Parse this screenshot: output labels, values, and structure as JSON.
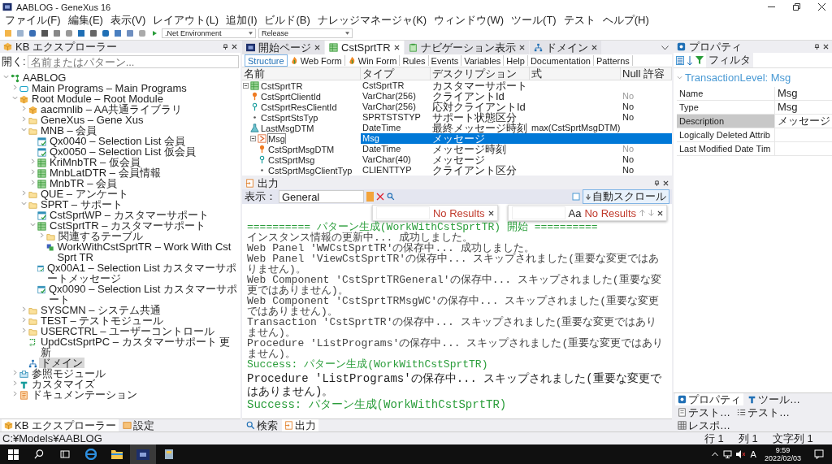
{
  "window": {
    "title": "AABLOG - GeneXus 16"
  },
  "menu": [
    "ファイル(F)",
    "編集(E)",
    "表示(V)",
    "レイアウト(L)",
    "追加(I)",
    "ビルド(B)",
    "ナレッジマネージャ(K)",
    "ウィンドウ(W)",
    "ツール(T)",
    "テスト",
    "ヘルプ(H)"
  ],
  "toolbar": {
    "environment": ".Net Environment",
    "configuration": "Release"
  },
  "kb_explorer": {
    "title": "KB エクスプローラー",
    "search_label": "開く:",
    "search_placeholder": "名前またはパターン...",
    "tree": [
      {
        "label": "AABLOG",
        "kind": "kb",
        "expanded": true,
        "selected": false,
        "children": [
          {
            "label": "Main Programs – Main Programs",
            "kind": "mainprog",
            "expanded": false,
            "selected": false
          },
          {
            "label": "Root Module – Root Module",
            "kind": "module",
            "expanded": true,
            "selected": false,
            "children": [
              {
                "label": "aacmnlib – AA共通ライブラリ",
                "kind": "module",
                "expanded": false,
                "selected": false
              },
              {
                "label": "GeneXus – Gene Xus",
                "kind": "folder",
                "expanded": false,
                "selected": false
              },
              {
                "label": "MNB – 会員",
                "kind": "folder",
                "expanded": true,
                "selected": false,
                "children": [
                  {
                    "label": "Qx0040 – Selection List 会員",
                    "kind": "webpanel",
                    "selected": false
                  },
                  {
                    "label": "Qx0050 – Selection List 仮会員",
                    "kind": "webpanel",
                    "selected": false
                  },
                  {
                    "label": "KriMnbTR – 仮会員",
                    "kind": "transaction",
                    "expanded": false,
                    "selected": false
                  },
                  {
                    "label": "MnbLatDTR – 会員情報",
                    "kind": "transaction",
                    "expanded": false,
                    "selected": false
                  },
                  {
                    "label": "MnbTR – 会員",
                    "kind": "transaction",
                    "expanded": false,
                    "selected": false
                  }
                ]
              },
              {
                "label": "QUE – アンケート",
                "kind": "folder",
                "expanded": false,
                "selected": false
              },
              {
                "label": "SPRT – サポート",
                "kind": "folder",
                "expanded": true,
                "selected": false,
                "children": [
                  {
                    "label": "CstSprtWP – カスタマーサポート",
                    "kind": "webpanel",
                    "selected": false
                  },
                  {
                    "label": "CstSprtTR – カスタマーサポート",
                    "kind": "transaction",
                    "expanded": true,
                    "selected": false,
                    "children": [
                      {
                        "label": "関連するテーブル",
                        "kind": "folder",
                        "expanded": false,
                        "selected": false
                      },
                      {
                        "label": "WorkWithCstSprtTR – Work With Cst Sprt TR",
                        "kind": "workwith",
                        "selected": false
                      }
                    ]
                  },
                  {
                    "label": "Qx00A1 – Selection List カスタマーサポートメッセージ",
                    "kind": "webpanel",
                    "selected": false
                  },
                  {
                    "label": "Qx0090 – Selection List カスタマーサポート",
                    "kind": "webpanel",
                    "selected": false
                  }
                ]
              },
              {
                "label": "SYSCMN – システム共通",
                "kind": "folder",
                "expanded": false,
                "selected": false
              },
              {
                "label": "TEST – テストモジュール",
                "kind": "folder",
                "expanded": false,
                "selected": false
              },
              {
                "label": "USERCTRL – ユーザーコントロール",
                "kind": "folder",
                "expanded": false,
                "selected": false
              },
              {
                "label": "UpdCstSprtPC – カスタマーサポート 更新",
                "kind": "procedure",
                "selected": false
              },
              {
                "label": "ドメイン",
                "kind": "domain",
                "selected": true
              }
            ]
          },
          {
            "label": "参照モジュール",
            "kind": "reference",
            "expanded": false,
            "selected": false
          },
          {
            "label": "カスタマイズ",
            "kind": "customize",
            "expanded": false,
            "selected": false
          },
          {
            "label": "ドキュメンテーション",
            "kind": "docs",
            "expanded": false,
            "selected": false
          }
        ]
      }
    ]
  },
  "editor_tabs": [
    {
      "label": "開始ページ",
      "kind": "startpage",
      "selected": false
    },
    {
      "label": "CstSprtTR",
      "kind": "transaction",
      "selected": true
    },
    {
      "label": "ナビゲーション表示",
      "kind": "navigation",
      "selected": false
    },
    {
      "label": "ドメイン",
      "kind": "domain",
      "selected": false
    }
  ],
  "section_tabs": [
    {
      "label": "Structure",
      "kind": "text",
      "selected": true
    },
    {
      "label": "Web Form",
      "kind": "form",
      "selected": false
    },
    {
      "label": "Win Form",
      "kind": "form",
      "selected": false
    },
    {
      "label": "Rules",
      "kind": "text",
      "selected": false
    },
    {
      "label": "Events",
      "kind": "text",
      "selected": false
    },
    {
      "label": "Variables",
      "kind": "text",
      "selected": false
    },
    {
      "label": "Help",
      "kind": "text",
      "selected": false
    },
    {
      "label": "Documentation",
      "kind": "text",
      "selected": false
    },
    {
      "label": "Patterns",
      "kind": "text",
      "selected": false
    }
  ],
  "structure": {
    "columns": [
      "名前",
      "タイプ",
      "デスクリプション",
      "式",
      "Null 許容"
    ],
    "rows": [
      {
        "name": "CstSprtTR",
        "type": "CstSprtTR",
        "description": "カスタマーサポート",
        "kind": "transaction",
        "expanded": true,
        "selected": false,
        "children": [
          {
            "name": "CstSprtClientId",
            "type": "VarChar(256)",
            "description": "クライアントId",
            "nullable": "No",
            "null_disabled": true,
            "kind": "key",
            "selected": false
          },
          {
            "name": "CstSprtResClientId",
            "type": "VarChar(256)",
            "description": "応対クライアントId",
            "nullable": "No",
            "null_disabled": false,
            "kind": "subkey",
            "selected": false
          },
          {
            "name": "CstSprtStsTyp",
            "type": "SPRTSTSTYP",
            "description": "サポート状態区分",
            "nullable": "No",
            "null_disabled": false,
            "kind": "attr",
            "selected": false
          },
          {
            "name": "LastMsgDTM",
            "type": "DateTime",
            "description": "最終メッセージ時刻",
            "formula": "max(CstSprtMsgDTM)",
            "kind": "formula",
            "selected": false
          },
          {
            "name": "Msg",
            "type": "Msg",
            "description": "メッセージ",
            "kind": "level",
            "expanded": true,
            "selected": true,
            "children": [
              {
                "name": "CstSprtMsgDTM",
                "type": "DateTime",
                "description": "メッセージ時刻",
                "nullable": "No",
                "null_disabled": true,
                "kind": "key",
                "selected": false
              },
              {
                "name": "CstSprtMsg",
                "type": "VarChar(40)",
                "description": "メッセージ",
                "nullable": "No",
                "null_disabled": false,
                "kind": "subkey",
                "selected": false
              },
              {
                "name": "CstSprtMsgClientTyp",
                "type": "CLIENTTYP",
                "description": "クライアント区分",
                "nullable": "No",
                "null_disabled": false,
                "kind": "attr",
                "selected": false
              }
            ]
          }
        ]
      }
    ]
  },
  "properties": {
    "title": "プロパティ",
    "filter_label": "フィルタ",
    "group": {
      "label": "TransactionLevel: Msg",
      "expanded": true
    },
    "rows": [
      {
        "name": "Name",
        "value": "Msg",
        "selected": false
      },
      {
        "name": "Type",
        "value": "Msg",
        "selected": false
      },
      {
        "name": "Description",
        "value": "メッセージ",
        "selected": true
      },
      {
        "name": "Logically Deleted Attrib",
        "selected": false
      },
      {
        "name": "Last Modified Date Tim",
        "selected": false
      }
    ]
  },
  "output": {
    "title": "出力",
    "show_label": "表示：",
    "channel": "General",
    "auto_scroll": "自動スクロール",
    "find_small": {
      "status": "No Results"
    },
    "find_large": {
      "case_label": "Aa",
      "status": "No Results"
    },
    "lines": [
      {
        "kind": "header",
        "text": "========== パターン生成(WorkWithCstSprtTR) 開始 =========="
      },
      {
        "kind": "normal",
        "text": "インスタンス情報の更新中... 成功しました。"
      },
      {
        "kind": "normal",
        "text": "Web Panel 'WWCstSprtTR'の保存中... 成功しました。"
      },
      {
        "kind": "normal",
        "text": "Web Panel 'ViewCstSprtTR'の保存中... スキップされました(重要な変更ではありません)。"
      },
      {
        "kind": "normal",
        "text": "Web Component 'CstSprtTRGeneral'の保存中... スキップされました(重要な変更ではありません)。"
      },
      {
        "kind": "normal",
        "text": "Web Component 'CstSprtTRMsgWC'の保存中... スキップされました(重要な変更ではありません)。"
      },
      {
        "kind": "normal",
        "text": "Transaction 'CstSprtTR'の保存中... スキップされました(重要な変更ではありません)。"
      },
      {
        "kind": "normal",
        "text": "Procedure 'ListPrograms'の保存中... スキップされました(重要な変更ではありません)。"
      },
      {
        "kind": "success",
        "text": "Success: パターン生成(WorkWithCstSprtTR)"
      }
    ],
    "large_lines": [
      {
        "kind": "normal",
        "text": "Procedure 'ListPrograms'の保存中... スキップされました(重要な変更ではありません)。"
      },
      {
        "kind": "success",
        "text": "Success: パターン生成(WorkWithCstSprtTR)"
      }
    ]
  },
  "bottom_tabs": {
    "left": [
      {
        "label": "KB エクスプローラー",
        "kind": "module",
        "selected": true
      },
      {
        "label": "設定",
        "kind": "settings",
        "selected": false
      }
    ],
    "center": [
      {
        "label": "検索",
        "kind": "search",
        "selected": false
      },
      {
        "label": "出力",
        "kind": "output",
        "selected": true
      }
    ],
    "right": [
      {
        "label": "プロパティ",
        "kind": "properties",
        "selected": true
      },
      {
        "label": "ツール…",
        "kind": "tool",
        "selected": false
      },
      {
        "label": "テスト…",
        "kind": "test",
        "selected": false
      },
      {
        "label": "テスト…",
        "kind": "list",
        "selected": false
      },
      {
        "label": "レスポ…",
        "kind": "grid",
        "selected": false
      }
    ]
  },
  "status_bar": {
    "path": "C:¥Models¥AABLOG",
    "line": "行 1",
    "column": "列 1",
    "chars": "文字列 1"
  },
  "taskbar": {
    "ime": "A",
    "time": "9:59",
    "date": "2022/02/03"
  }
}
